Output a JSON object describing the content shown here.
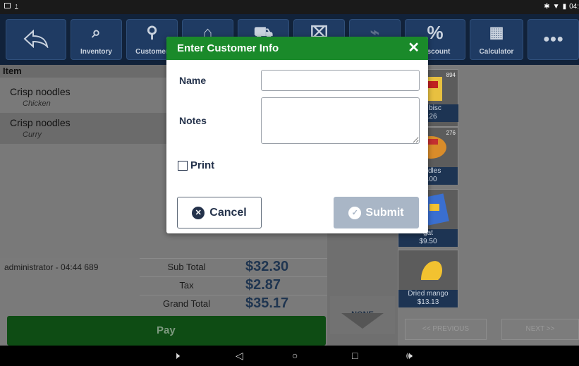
{
  "toolbar": {
    "buttons": [
      {
        "label": "",
        "icon": "back-arrow-icon"
      },
      {
        "label": "Inventory",
        "icon": "search-icon"
      },
      {
        "label": "Customer",
        "icon": "add-user-icon"
      },
      {
        "label": "",
        "icon": "store-icon"
      },
      {
        "label": "",
        "icon": "cart-icon"
      },
      {
        "label": "",
        "icon": "trash-icon"
      },
      {
        "label": "",
        "icon": "tag-icon"
      },
      {
        "label": "Discount",
        "icon": "percent-icon"
      },
      {
        "label": "Calculator",
        "icon": "calculator-icon"
      },
      {
        "label": "",
        "icon": "more-icon"
      }
    ]
  },
  "order": {
    "header": "Item",
    "items": [
      {
        "name": "Crisp noodles",
        "modifier": "Chicken"
      },
      {
        "name": "Crisp noodles",
        "modifier": "Curry"
      }
    ],
    "user_line": "administrator - 04:44 689"
  },
  "totals": {
    "subtotal_label": "Sub Total",
    "subtotal": "$32.30",
    "tax_label": "Tax",
    "tax": "$2.87",
    "grand_label": "Grand Total",
    "grand": "$35.17"
  },
  "pay_label": "Pay",
  "category": {
    "none_label": "NONE"
  },
  "products": [
    {
      "name": "",
      "price": "",
      "stock": "894",
      "color": "#f0d060"
    },
    {
      "name": "afer bisc",
      "price": "$1.26",
      "stock": "",
      "color": "#f0d060"
    },
    {
      "name": "Noodles",
      "price": "$0.00",
      "stock": "276",
      "color": "#d98c2a"
    },
    {
      "name": "gat",
      "price": "$9.50",
      "stock": "",
      "color": "#3a6fd0"
    },
    {
      "name": "Dried mango",
      "price": "$13.13",
      "stock": "",
      "color": "#f2c230"
    }
  ],
  "pager": {
    "prev": "<< PREVIOUS",
    "next": "NEXT >>"
  },
  "dialog": {
    "title": "Enter Customer Info",
    "close": "✕",
    "name_label": "Name",
    "name_value": "",
    "notes_label": "Notes",
    "notes_value": "",
    "print_label": "Print",
    "cancel_label": "Cancel",
    "submit_label": "Submit"
  },
  "status": {
    "time": "04:"
  }
}
